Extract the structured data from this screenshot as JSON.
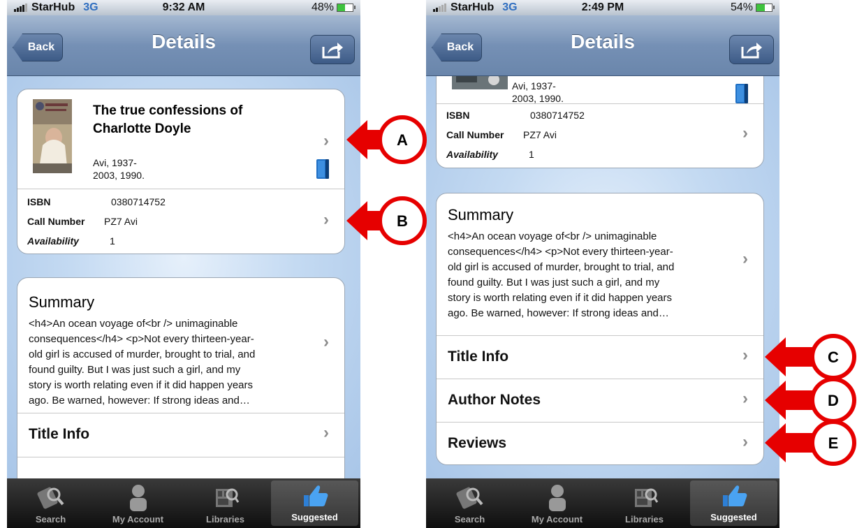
{
  "status_left": {
    "carrier": "StarHub",
    "network": "3G",
    "time": "9:32 AM",
    "battery": "48%"
  },
  "status_right": {
    "carrier": "StarHub",
    "network": "3G",
    "time": "2:49 PM",
    "battery": "54%"
  },
  "nav": {
    "back": "Back",
    "title": "Details"
  },
  "book": {
    "title_line1": "The true confessions of",
    "title_line2": "Charlotte Doyle",
    "author_line1": "Avi, 1937-",
    "author_line2": "2003, 1990.",
    "author_cut": "Avi, 1937-"
  },
  "fields": {
    "isbn_label": "ISBN",
    "isbn_value": "0380714752",
    "call_label": "Call Number",
    "call_value": "PZ7 Avi",
    "avail_label": "Availability",
    "avail_value": "1"
  },
  "summary": {
    "heading": "Summary",
    "lines": [
      "<h4>An ocean voyage of<br /> unimaginable",
      "consequences</h4> <p>Not every thirteen-year-",
      "old girl is accused of murder, brought to trial, and",
      "found guilty. But I was just such a girl, and my",
      "story is worth relating even if it did happen years",
      "ago. Be warned, however: If strong ideas and…"
    ]
  },
  "sections": {
    "title_info": "Title Info",
    "author_notes": "Author Notes",
    "reviews": "Reviews"
  },
  "tabs": [
    "Search",
    "My Account",
    "Libraries",
    "Suggested"
  ],
  "callouts": {
    "a": "A",
    "b": "B",
    "c": "C",
    "d": "D",
    "e": "E"
  },
  "colors": {
    "callout_red": "#e60000",
    "nav_blue": "#6a86ab"
  }
}
